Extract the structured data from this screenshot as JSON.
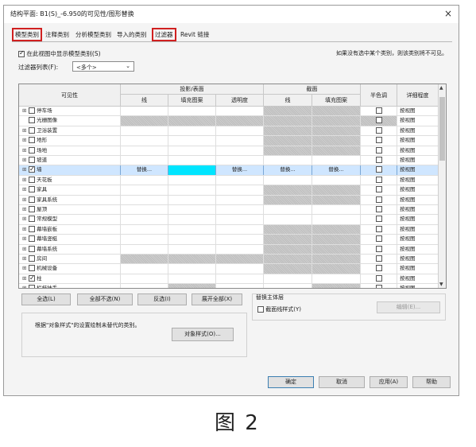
{
  "window": {
    "title": "结构平面: B1(S)_-6.950的可见性/图形替换",
    "close": "×"
  },
  "tabs": [
    {
      "label": "模型类别",
      "boxed": true
    },
    {
      "label": "注释类别",
      "boxed": false
    },
    {
      "label": "分析模型类别",
      "boxed": false
    },
    {
      "label": "导入的类别",
      "boxed": false
    },
    {
      "label": "过滤器",
      "boxed": true
    },
    {
      "label": "Revit 链接",
      "boxed": false
    }
  ],
  "show_model_label": "在此视图中显示模型类别(S)",
  "note": "如果没有选中某个类别，则该类别将不可见。",
  "filter_list": {
    "label": "过滤器列表(F):",
    "value": "<多个>"
  },
  "grid": {
    "headers": {
      "visibility": "可见性",
      "projection": "投影/表面",
      "cut": "截面",
      "halftone": "半色调",
      "detail": "详细程度",
      "lines": "线",
      "pattern": "填充图案",
      "transparency": "透明度",
      "cut_lines": "线",
      "cut_pattern": "填充图案"
    },
    "rows": [
      {
        "name": "停车场",
        "expand": "⊞",
        "checked": false,
        "detail": "按视图",
        "selected": false
      },
      {
        "name": "光栅图像",
        "expand": "",
        "checked": false,
        "detail": "按视图",
        "selected": false
      },
      {
        "name": "卫浴装置",
        "expand": "⊞",
        "checked": false,
        "detail": "按视图",
        "selected": false
      },
      {
        "name": "地形",
        "expand": "⊞",
        "checked": false,
        "detail": "按视图",
        "selected": false
      },
      {
        "name": "场地",
        "expand": "⊞",
        "checked": false,
        "detail": "按视图",
        "selected": false
      },
      {
        "name": "坡道",
        "expand": "⊞",
        "checked": false,
        "detail": "按视图",
        "selected": false
      },
      {
        "name": "墙",
        "expand": "⊞",
        "checked": true,
        "detail": "按视图",
        "selected": true,
        "override": "替换..."
      },
      {
        "name": "天花板",
        "expand": "⊞",
        "checked": false,
        "detail": "按视图",
        "selected": false
      },
      {
        "name": "家具",
        "expand": "⊞",
        "checked": false,
        "detail": "按视图",
        "selected": false
      },
      {
        "name": "家具系统",
        "expand": "⊞",
        "checked": false,
        "detail": "按视图",
        "selected": false
      },
      {
        "name": "屋顶",
        "expand": "⊞",
        "checked": false,
        "detail": "按视图",
        "selected": false
      },
      {
        "name": "常规模型",
        "expand": "⊞",
        "checked": false,
        "detail": "按视图",
        "selected": false
      },
      {
        "name": "幕墙嵌板",
        "expand": "⊞",
        "checked": false,
        "detail": "按视图",
        "selected": false
      },
      {
        "name": "幕墙竖梃",
        "expand": "⊞",
        "checked": false,
        "detail": "按视图",
        "selected": false
      },
      {
        "name": "幕墙系统",
        "expand": "⊞",
        "checked": false,
        "detail": "按视图",
        "selected": false
      },
      {
        "name": "房间",
        "expand": "⊞",
        "checked": false,
        "detail": "按视图",
        "selected": false
      },
      {
        "name": "机械设备",
        "expand": "⊞",
        "checked": false,
        "detail": "按视图",
        "selected": false
      },
      {
        "name": "柱",
        "expand": "⊞",
        "checked": true,
        "detail": "按视图",
        "selected": false
      },
      {
        "name": "栏杆扶手",
        "expand": "⊞",
        "checked": false,
        "detail": "按视图",
        "selected": false
      }
    ]
  },
  "buttons": {
    "select_all": "全选(L)",
    "select_none": "全部不选(N)",
    "invert": "反选(I)",
    "expand_all": "展开全部(X)",
    "object_styles": "对象样式(O)...",
    "edit": "编辑(E)...",
    "ok": "确定",
    "cancel": "取消",
    "apply": "应用(A)",
    "help": "帮助"
  },
  "host_layer": {
    "title": "替换主体层",
    "cut_line_styles": "截面线样式(Y)"
  },
  "object_styles_note": "根据\"对象样式\"的设置绘制未替代的类别。",
  "caption": "图 2",
  "colors": {
    "selected_row": "#cfe6ff",
    "cyan_override": "#00e5ff",
    "highlight_box": "#d02020"
  }
}
